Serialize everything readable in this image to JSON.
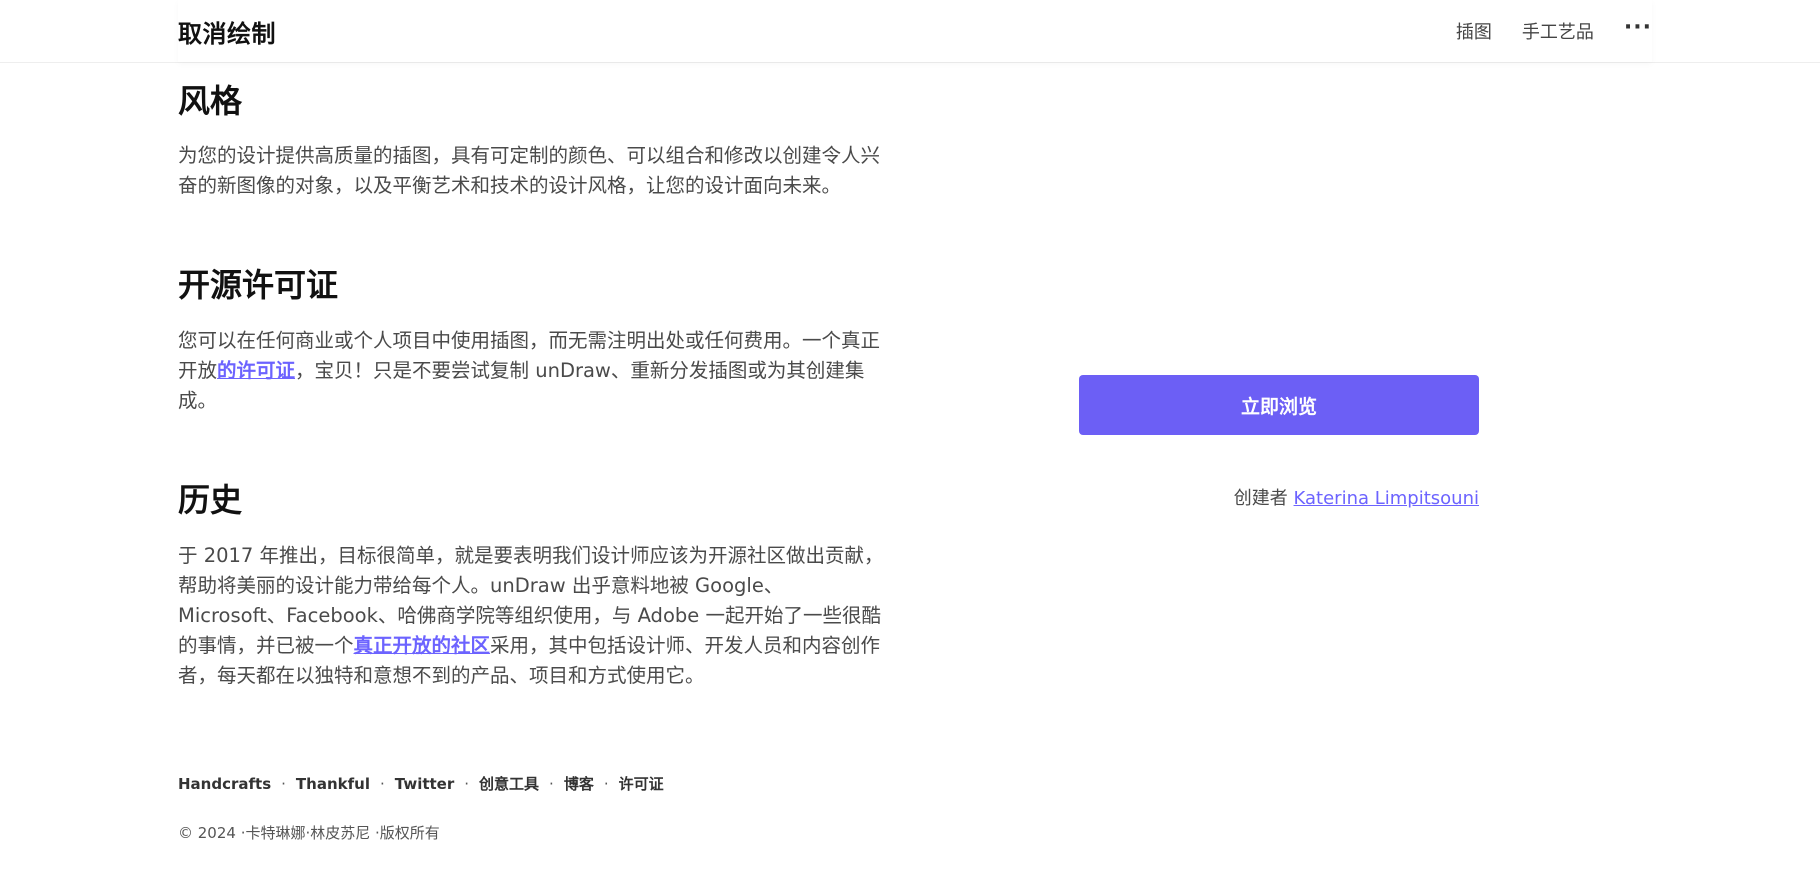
{
  "header": {
    "brand": "取消绘制",
    "nav": [
      "插图",
      "手工艺品"
    ],
    "more": "···"
  },
  "sections": [
    {
      "title": "风格",
      "text": "为您的设计提供高质量的插图，具有可定制的颜色、可以组合和修改以创建令人兴奋的新图像的对象，以及平衡艺术和技术的设计风格，让您的设计面向未来。"
    },
    {
      "title": "开源许可证",
      "text_before": "您可以在任何商业或个人项目中使用插图，而无需注明出处或任何费用。一个真正开放",
      "link": "的许可证",
      "text_after": "，宝贝！只是不要尝试复制 unDraw、重新分发插图或为其创建集成。"
    },
    {
      "title": "历史",
      "text_before": "于 2017 年推出，目标很简单，就是要表明我们设计师应该为开源社区做出贡献，帮助将美丽的设计能力带给每个人。unDraw 出乎意料地被 Google、Microsoft、Facebook、哈佛商学院等组织使用，与 Adobe 一起开始了一些很酷的事情，并已被一个",
      "link": "真正开放的社区",
      "text_after": "采用，其中包括设计师、开发人员和内容创作者，每天都在以独特和意想不到的产品、项目和方式使用它。"
    }
  ],
  "sidebar": {
    "cta_label": "立即浏览",
    "creator_prefix": "创建者",
    "creator_name": "Katerina Limpitsouni"
  },
  "footer": {
    "links": [
      "Handcrafts",
      "Thankful",
      "Twitter",
      "创意工具",
      "博客",
      "许可证"
    ],
    "separator": "·",
    "copyright": "© 2024 ·卡特琳娜·林皮苏尼 ·版权所有"
  },
  "colors": {
    "accent": "#6c5ff5",
    "link": "#6c63ff"
  }
}
